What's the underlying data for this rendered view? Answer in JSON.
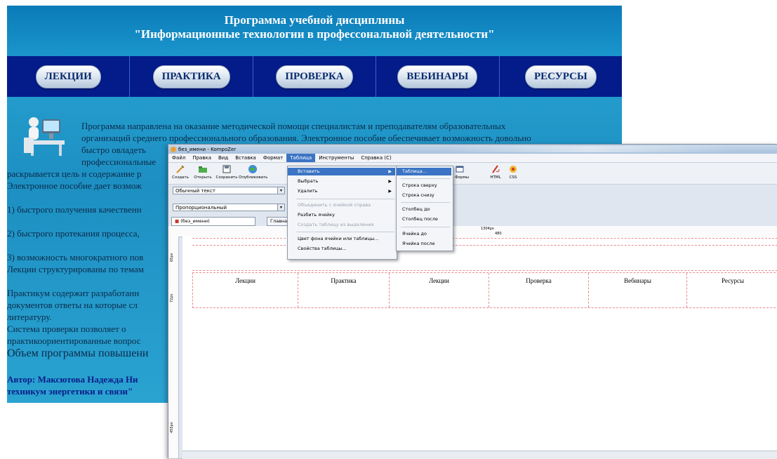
{
  "site": {
    "title_line1": "Программа учебной дисциплины",
    "title_line2": "\"Информационные технологии в профессональной деятельности\"",
    "nav": [
      "ЛЕКЦИИ",
      "ПРАКТИКА",
      "ПРОВЕРКА",
      "ВЕБИНАРЫ",
      "РЕСУРСЫ"
    ],
    "intro1": "Программа направлена на оказание методической помощи специалистам и преподавателям образовательных",
    "intro2": "организаций  среднего профессионального образования. Электронное пособие обеспечивает возможность довольно",
    "intro3": "быстро  овладеть",
    "intro4": "профессиональные",
    "line_purpose": "раскрывается цель и содержание р",
    "line_manual": "Электронное пособие дает возмож",
    "point1": "1) быстрого получения качественн",
    "point2": "2) быстрого протекания процесса,",
    "point3": "3) возможность многократного пов",
    "line_lectures": "Лекции структурированы по темам",
    "practice1": "Практикум  содержит  разработанн",
    "practice2": "документов ответы на которые сл",
    "practice3": "литературу.",
    "check1": "Система   проверки   позволяет   о",
    "check2": "практикоориентированные вопрос",
    "volume": "Объем программы повышени",
    "author1": "Автор:  Максютова  Надежда  Ни",
    "author2": "техникум энергетики и связи\""
  },
  "window": {
    "title": "без_имени - KompoZer",
    "menubar": [
      "Файл",
      "Правка",
      "Вид",
      "Вставка",
      "Формат",
      "Таблица",
      "Инструменты",
      "Справка (С)"
    ],
    "active_menu_index": 5,
    "toolbar": [
      "Создать",
      "Открыть",
      "Сохранить",
      "Опубликовать",
      "ы Формы",
      "HTML",
      "CSS"
    ],
    "format_select": "Обычный текст",
    "font_select": "Пропорциональный",
    "tabs": [
      "(без_имени)",
      "Главна"
    ],
    "ruler_label": "1304px",
    "ruler_label2": "480",
    "vruler": [
      "65px",
      "72px",
      "455px"
    ],
    "table_cells": [
      "Лекции",
      "Практика",
      "Лекции",
      "Проверка",
      "Вебинары",
      "Ресурсы"
    ]
  },
  "table_menu": {
    "items": [
      {
        "label": "Вставить",
        "state": "highlight",
        "submenu": true
      },
      {
        "label": "Выбрать",
        "state": "normal",
        "submenu": true
      },
      {
        "label": "Удалить",
        "state": "normal",
        "submenu": true
      },
      {
        "label": "Объединить с ячейкой справа",
        "state": "disabled",
        "submenu": false
      },
      {
        "label": "Разбить ячейку",
        "state": "normal",
        "submenu": false
      },
      {
        "label": "Создать таблицу из выделения",
        "state": "disabled",
        "submenu": false
      },
      {
        "label": "Цвет фона ячейки или таблицы...",
        "state": "normal",
        "submenu": false
      },
      {
        "label": "Свойства таблицы...",
        "state": "normal",
        "submenu": false
      }
    ]
  },
  "insert_menu": {
    "items": [
      "Таблица...",
      "Строка сверху",
      "Строка снизу",
      "Столбец до",
      "Столбец после",
      "Ячейка до",
      "Ячейка после"
    ]
  },
  "colors": {
    "nav_bg": "#041b8a",
    "header_text": "#ffffff",
    "menu_highlight": "#3b74c4",
    "table_border": "#e88d8d"
  }
}
